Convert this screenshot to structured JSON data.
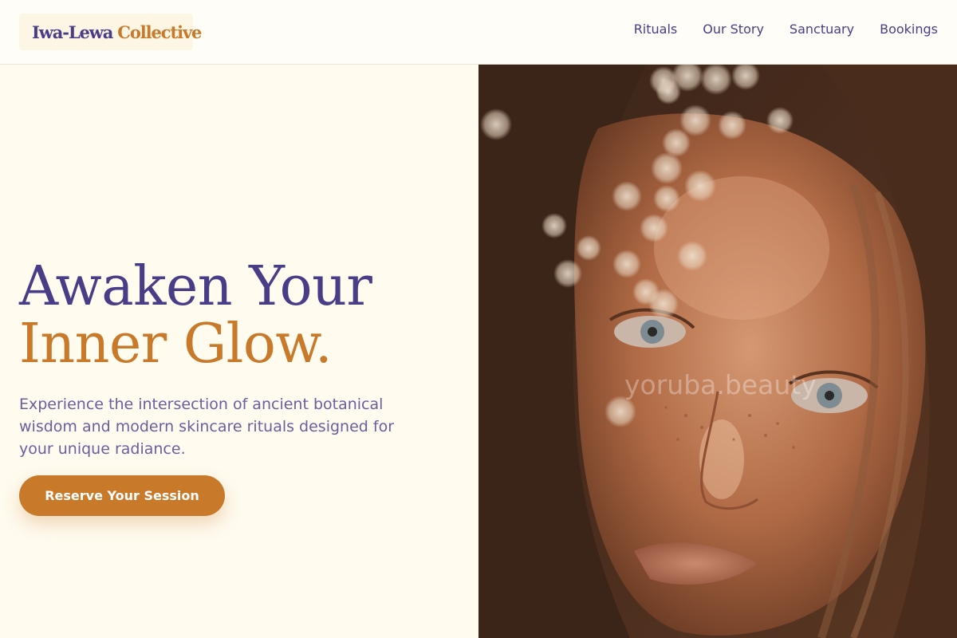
{
  "brand": {
    "name_part1": "Iwa-Lewa",
    "name_part2": "Collective",
    "primary_color": "#4a3d87",
    "accent_color": "#c8792a"
  },
  "nav": {
    "items": [
      {
        "label": "Rituals"
      },
      {
        "label": "Our Story"
      },
      {
        "label": "Sanctuary"
      },
      {
        "label": "Bookings"
      }
    ]
  },
  "hero": {
    "headline_line1": "Awaken Your",
    "headline_line2": "Inner Glow.",
    "subtext": "Experience the intersection of ancient botanical wisdom and modern skincare rituals designed for your unique radiance.",
    "cta_label": "Reserve Your Session"
  },
  "photo": {
    "watermark": "yoruba.beauty"
  }
}
